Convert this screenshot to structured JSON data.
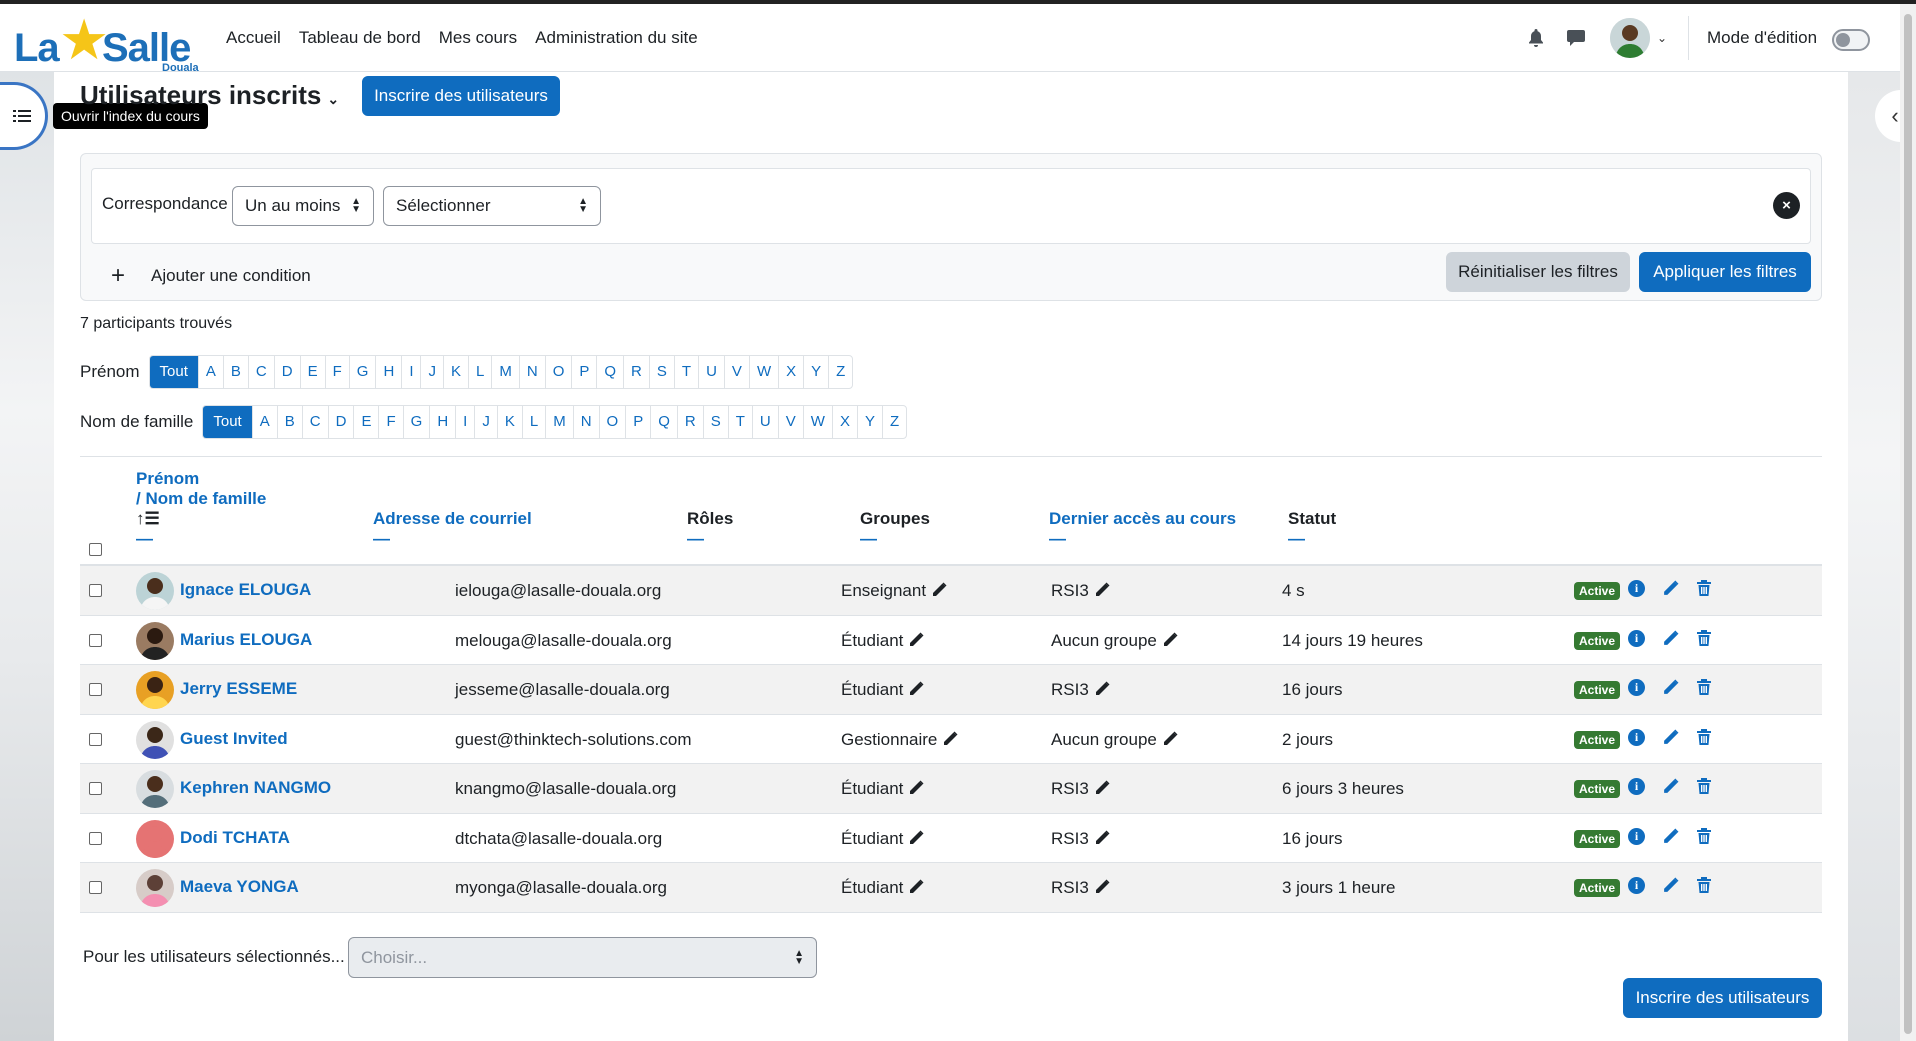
{
  "logo": {
    "la": "La",
    "salle": "Salle",
    "sub": "Douala"
  },
  "nav": {
    "items": [
      "Accueil",
      "Tableau de bord",
      "Mes cours",
      "Administration du site"
    ],
    "mode_edition": "Mode d'édition"
  },
  "tooltip": "Ouvrir l'index du cours",
  "page": {
    "title": "Utilisateurs inscrits",
    "enrol_button": "Inscrire des utilisateurs"
  },
  "filters": {
    "match_label": "Correspondance",
    "match_value": "Un au moins",
    "select_value": "Sélectionner",
    "add_condition": "Ajouter une condition",
    "reset": "Réinitialiser les filtres",
    "apply": "Appliquer les filtres"
  },
  "found": "7 participants trouvés",
  "initials": {
    "firstname_label": "Prénom",
    "lastname_label": "Nom de famille",
    "all": "Tout",
    "letters": [
      "A",
      "B",
      "C",
      "D",
      "E",
      "F",
      "G",
      "H",
      "I",
      "J",
      "K",
      "L",
      "M",
      "N",
      "O",
      "P",
      "Q",
      "R",
      "S",
      "T",
      "U",
      "V",
      "W",
      "X",
      "Y",
      "Z"
    ]
  },
  "table": {
    "headers": {
      "firstname": "Prénom",
      "lastname": "/ Nom de famille",
      "email": "Adresse de courriel",
      "roles": "Rôles",
      "groups": "Groupes",
      "lastaccess": "Dernier accès au cours",
      "status": "Statut",
      "dash": "—"
    },
    "rows": [
      {
        "name": "Ignace ELOUGA",
        "email": "ielouga@lasalle-douala.org",
        "role": "Enseignant",
        "group": "RSI3",
        "last": "4 s",
        "status": "Active"
      },
      {
        "name": "Marius ELOUGA",
        "email": "melouga@lasalle-douala.org",
        "role": "Étudiant",
        "group": "Aucun groupe",
        "last": "14 jours 19 heures",
        "status": "Active"
      },
      {
        "name": "Jerry ESSEME",
        "email": "jesseme@lasalle-douala.org",
        "role": "Étudiant",
        "group": "RSI3",
        "last": "16 jours",
        "status": "Active"
      },
      {
        "name": "Guest Invited",
        "email": "guest@thinktech-solutions.com",
        "role": "Gestionnaire",
        "group": "Aucun groupe",
        "last": "2 jours",
        "status": "Active"
      },
      {
        "name": "Kephren NANGMO",
        "email": "knangmo@lasalle-douala.org",
        "role": "Étudiant",
        "group": "RSI3",
        "last": "6 jours 3 heures",
        "status": "Active"
      },
      {
        "name": "Dodi TCHATA",
        "email": "dtchata@lasalle-douala.org",
        "role": "Étudiant",
        "group": "RSI3",
        "last": "16 jours",
        "status": "Active"
      },
      {
        "name": "Maeva YONGA",
        "email": "myonga@lasalle-douala.org",
        "role": "Étudiant",
        "group": "RSI3",
        "last": "3 jours 1 heure",
        "status": "Active"
      }
    ]
  },
  "bottom": {
    "label": "Pour les utilisateurs sélectionnés...",
    "choose": "Choisir...",
    "enrol_button": "Inscrire des utilisateurs"
  },
  "colors": {
    "primary": "#0f6cbf",
    "active_badge": "#357a32",
    "logo_blue": "#1d6fb8",
    "logo_star": "#f5c518"
  }
}
